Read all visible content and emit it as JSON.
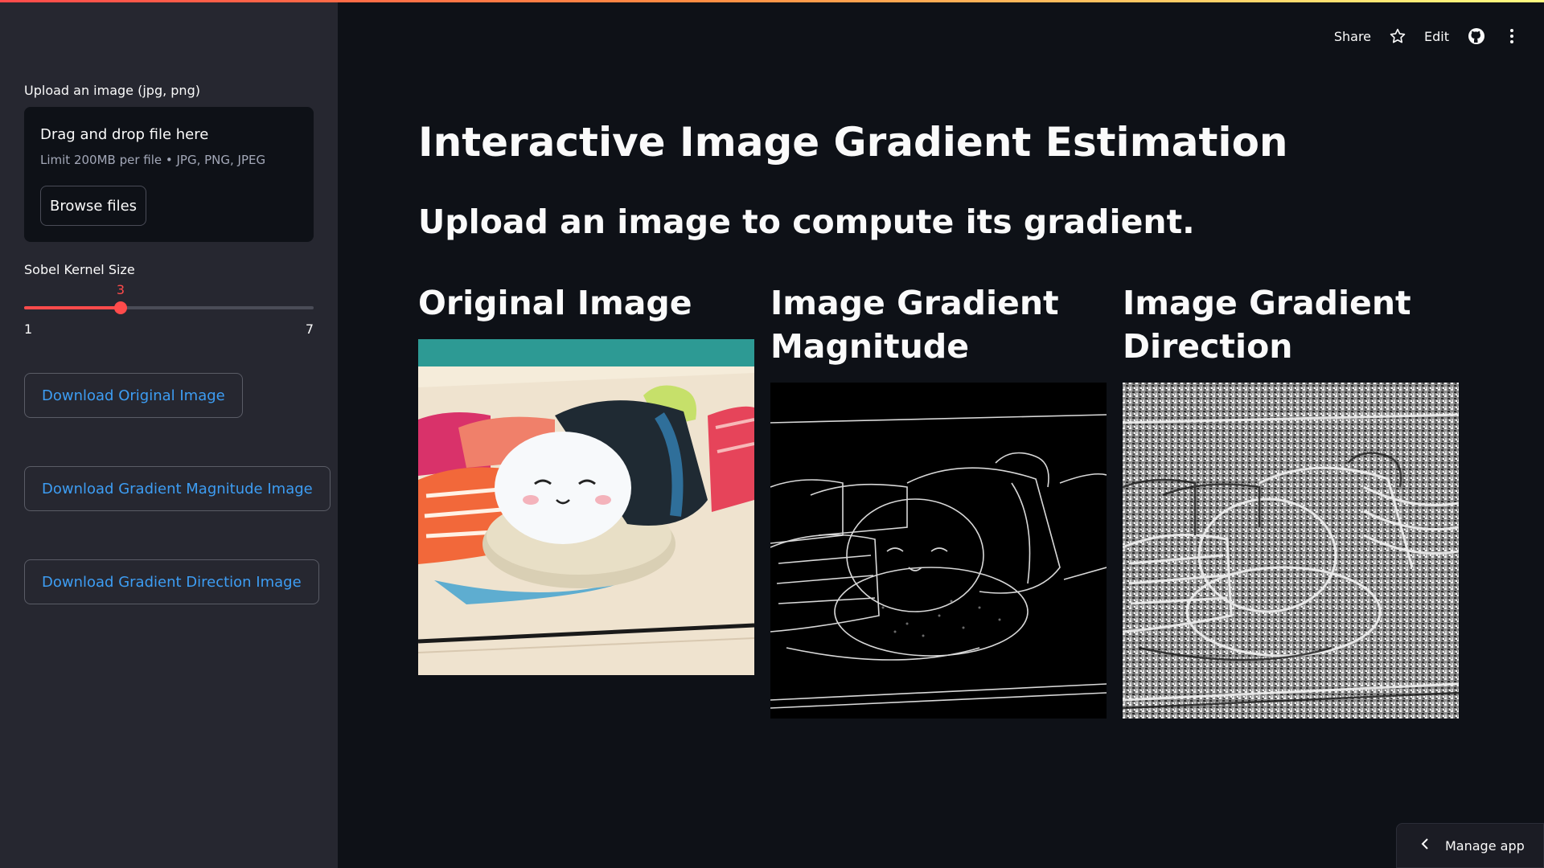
{
  "sidebar": {
    "upload_label": "Upload an image (jpg, png)",
    "dropzone_title": "Drag and drop file here",
    "dropzone_limit": "Limit 200MB per file • JPG, PNG, JPEG",
    "browse_label": "Browse files",
    "slider": {
      "label": "Sobel Kernel Size",
      "value": 3,
      "min": 1,
      "max": 7,
      "value_label": "3",
      "min_label": "1",
      "max_label": "7"
    },
    "buttons": {
      "download_original": "Download Original Image",
      "download_magnitude": "Download Gradient Magnitude Image",
      "download_direction": "Download Gradient Direction Image"
    }
  },
  "header": {
    "share": "Share",
    "edit": "Edit",
    "icons": [
      "star-icon",
      "github-icon",
      "more-vertical-icon"
    ]
  },
  "main": {
    "title": "Interactive Image Gradient Estimation",
    "subtitle": "Upload an image to compute its gradient.",
    "columns": [
      {
        "heading": "Original Image"
      },
      {
        "heading": "Image Gradient Magnitude"
      },
      {
        "heading": "Image Gradient Direction"
      }
    ]
  },
  "footer": {
    "manage_app": "Manage app"
  },
  "colors": {
    "accent": "#ff4b4b",
    "link": "#3d9df3",
    "sidebar_bg": "#262730",
    "main_bg": "#0e1117"
  }
}
